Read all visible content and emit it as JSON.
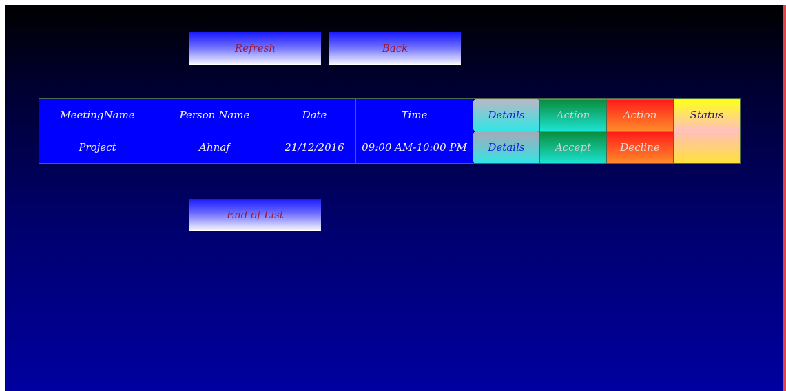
{
  "toolbar": {
    "refresh_label": "Refresh",
    "back_label": "Back"
  },
  "table": {
    "headers": {
      "meeting_name": "MeetingName",
      "person_name": "Person Name",
      "date": "Date",
      "time": "Time",
      "details": "Details",
      "action_accept": "Action",
      "action_decline": "Action",
      "status": "Status"
    },
    "rows": [
      {
        "meeting_name": "Project",
        "person_name": "Ahnaf",
        "date": "21/12/2016",
        "time": "09:00 AM-10:00 PM",
        "details_label": "Details",
        "accept_label": "Accept",
        "decline_label": "Decline",
        "status": ""
      }
    ]
  },
  "footer": {
    "end_label": "End of List"
  },
  "colors": {
    "cell_blue": "#0000ff",
    "button_text": "#9b1b3c",
    "accept_green": "#0a8c3a",
    "decline_red": "#ff1a1a",
    "status_yellow": "#ffff1a"
  }
}
